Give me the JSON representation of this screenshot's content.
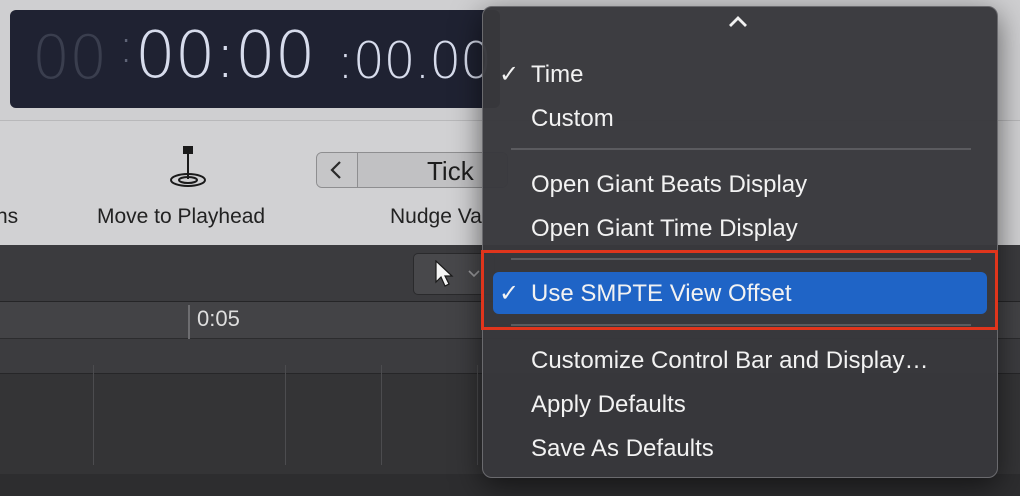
{
  "lcd": {
    "hours": "00",
    "colon_dim": ":",
    "time_main": "00:00",
    "time_fraction": ":00.00"
  },
  "toolbar": {
    "left_cut_label": "ns",
    "move_to_playhead_label": "Move to Playhead",
    "nudge_label": "Nudge Va",
    "nudge_value": "Tick"
  },
  "ruler": {
    "marker_label": "0:05"
  },
  "menu": {
    "scroll_up_icon": "chevron-up-icon",
    "items": [
      {
        "label": "Time",
        "checked": "✓"
      },
      {
        "label": "Custom",
        "checked": ""
      },
      {
        "label": "Open Giant Beats Display",
        "checked": ""
      },
      {
        "label": "Open Giant Time Display",
        "checked": ""
      },
      {
        "label": "Use SMPTE View Offset",
        "checked": "✓"
      },
      {
        "label": "Customize Control Bar and Display…",
        "checked": ""
      },
      {
        "label": "Apply Defaults",
        "checked": ""
      },
      {
        "label": "Save As Defaults",
        "checked": ""
      }
    ]
  },
  "colors": {
    "highlight_outline": "#e0351c",
    "selected_item": "#1f64c6"
  }
}
